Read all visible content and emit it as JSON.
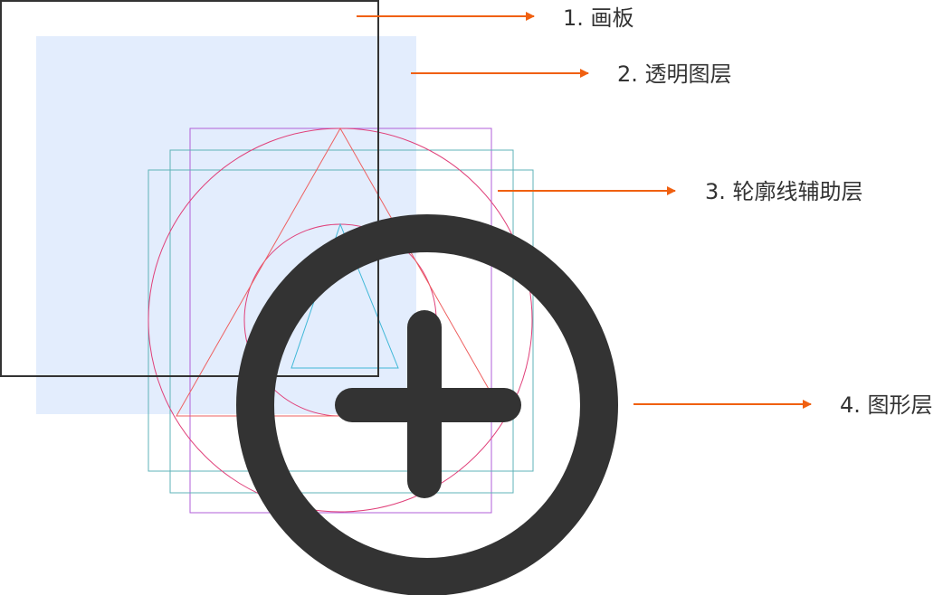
{
  "labels": {
    "artboard": "1. 画板",
    "transparent_layer": "2. 透明图层",
    "outline_guide_layer": "3.  轮廓线辅助层",
    "shape_layer": "4. 图形层"
  },
  "colors": {
    "artboard_border": "#333333",
    "transparent_fill": "#e3edfd",
    "guide_purple": "#b25fd8",
    "guide_teal": "#5fb3b8",
    "guide_pink": "#e0407a",
    "guide_red": "#ee6060",
    "guide_cyan": "#40b8d8",
    "arrow": "#f06010",
    "shape": "#333333",
    "text": "#333333"
  },
  "icon": "plus-circle-icon"
}
